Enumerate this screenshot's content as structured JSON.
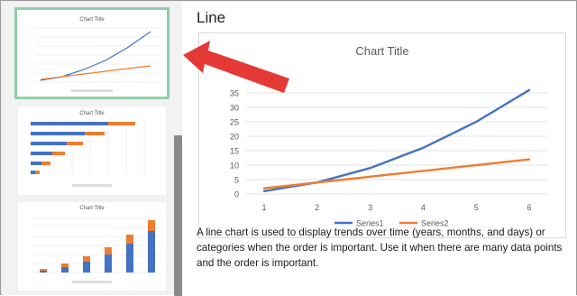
{
  "panel_title": "Line",
  "description": "A line chart is used to display trends over time (years, months, and days) or categories when the order is important. Use it when there are many data points and the order is important.",
  "colors": {
    "series1": "#4472c4",
    "series2": "#ed7d31",
    "thumb_selected_border": "#8fcfa6",
    "arrow": "#e53935"
  },
  "thumbnails": [
    {
      "title": "Chart Title",
      "type": "line",
      "selected": true
    },
    {
      "title": "Chart Title",
      "type": "bar",
      "selected": false
    },
    {
      "title": "Chart Title",
      "type": "stacked-column",
      "selected": false
    }
  ],
  "chart_data": {
    "type": "line",
    "title": "Chart Title",
    "categories": [
      "1",
      "2",
      "3",
      "4",
      "5",
      "6"
    ],
    "series": [
      {
        "name": "Series1",
        "values": [
          1,
          4,
          9,
          16,
          25,
          36
        ]
      },
      {
        "name": "Series2",
        "values": [
          2,
          4,
          6,
          8,
          10,
          12
        ]
      }
    ],
    "yticks": [
      "0",
      "5",
      "10",
      "15",
      "20",
      "25",
      "30",
      "35"
    ],
    "ylim": [
      0,
      40
    ],
    "grid": true,
    "legend": "bottom"
  }
}
